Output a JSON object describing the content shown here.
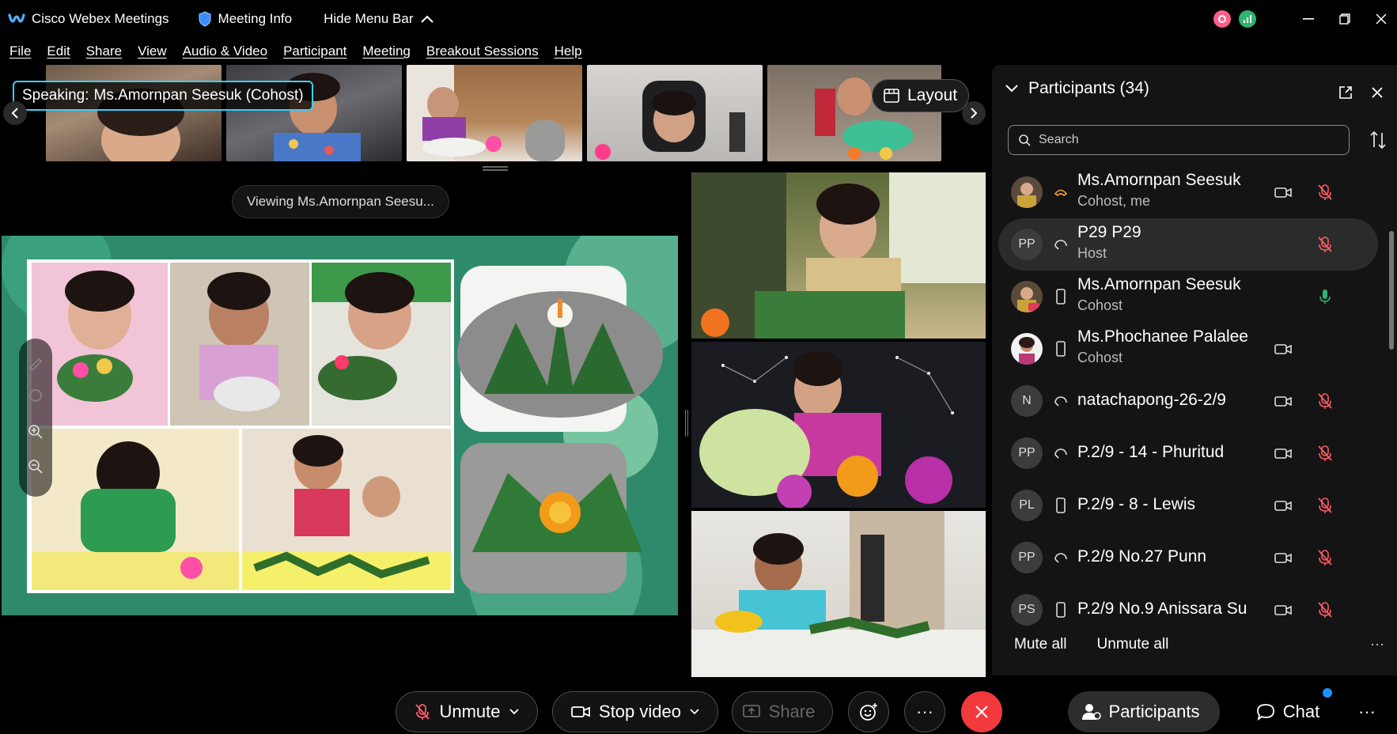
{
  "titlebar": {
    "app_title": "Cisco Webex Meetings",
    "meeting_info": "Meeting Info",
    "hide_menu_bar": "Hide Menu Bar"
  },
  "menubar": {
    "items": [
      "File",
      "Edit",
      "Share",
      "View",
      "Audio & Video",
      "Participant",
      "Meeting",
      "Breakout Sessions",
      "Help"
    ]
  },
  "strip": {
    "speaking_label": "Speaking:",
    "speaking_name": "Ms.Amornpan Seesuk (Cohost)",
    "layout_label": "Layout"
  },
  "stage": {
    "viewing_label": "Viewing Ms.Amornpan Seesu..."
  },
  "panel": {
    "title": "Participants (34)",
    "search_placeholder": "Search",
    "participants": [
      {
        "name": "Ms.Amornpan Seesuk",
        "role": "Cohost, me",
        "avatar": "photo",
        "device": "phone-audio-icon",
        "video": true,
        "muted": true
      },
      {
        "name": "P29 P29",
        "role": "Host",
        "avatar": "PP",
        "device": "headset-audio-icon",
        "video": false,
        "muted": true
      },
      {
        "name": "Ms.Amornpan Seesuk",
        "role": "Cohost",
        "avatar": "photo",
        "device": "mobile-device-icon",
        "video": false,
        "muted": false
      },
      {
        "name": "Ms.Phochanee Palalee",
        "role": "Cohost",
        "avatar": "photo",
        "device": "mobile-device-icon",
        "video": true,
        "muted": false
      },
      {
        "name": "natachapong-26-2/9",
        "role": "",
        "avatar": "N",
        "device": "headset-audio-icon",
        "video": true,
        "muted": true
      },
      {
        "name": "P.2/9 - 14 - Phuritud",
        "role": "",
        "avatar": "PP",
        "device": "headset-audio-icon",
        "video": true,
        "muted": true
      },
      {
        "name": "P.2/9 - 8 - Lewis",
        "role": "",
        "avatar": "PL",
        "device": "mobile-device-icon",
        "video": true,
        "muted": true
      },
      {
        "name": "P.2/9 No.27 Punn",
        "role": "",
        "avatar": "PP",
        "device": "headset-audio-icon",
        "video": true,
        "muted": true
      },
      {
        "name": "P.2/9 No.9 Anissara Su",
        "role": "",
        "avatar": "PS",
        "device": "mobile-device-icon",
        "video": true,
        "muted": true
      }
    ],
    "mute_all": "Mute all",
    "unmute_all": "Unmute all",
    "more": "···"
  },
  "controls": {
    "unmute": "Unmute",
    "stop_video": "Stop video",
    "share": "Share",
    "more": "···",
    "participants": "Participants",
    "chat": "Chat",
    "overflow": "···"
  },
  "colors": {
    "accent": "#39d0ff",
    "end_call": "#f2393c",
    "muted_red": "#ff5a66",
    "mic_green": "#2fb36d",
    "panel_bg": "#141414"
  }
}
